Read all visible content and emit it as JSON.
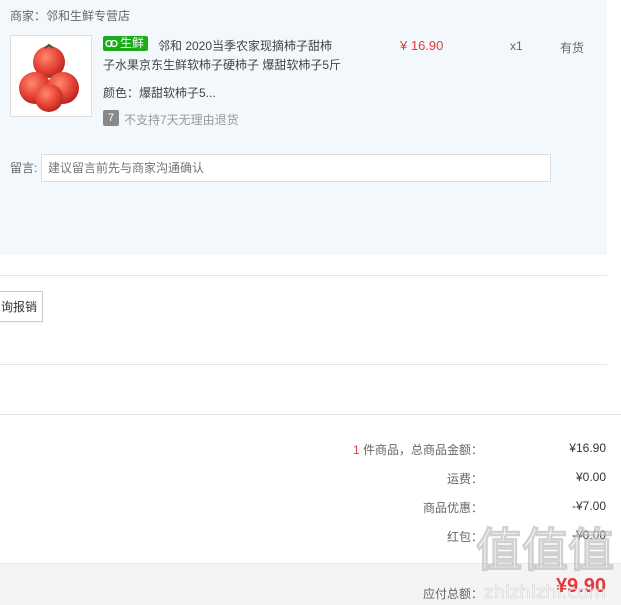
{
  "merchant": {
    "label": "商家：邻和生鲜专营店"
  },
  "item": {
    "badge": "生鲜",
    "title_line1": "邻和 2020当季农家现摘柿子甜柿",
    "title_line2": "子水果京东生鲜软柿子硬柿子 爆甜软柿子5斤",
    "variant": "颜色：爆甜软柿子5...",
    "return_icon": "7",
    "return_policy": "不支持7天无理由退货",
    "price": "¥ 16.90",
    "quantity": "x1",
    "stock": "有货"
  },
  "message": {
    "label": "留言:",
    "placeholder": "建议留言前先与商家沟通确认"
  },
  "reimbursement_button": "询报销",
  "summary": {
    "count": "1",
    "total_label": " 件商品，总商品金额：",
    "total_value": "¥16.90",
    "shipping_label": "运费：",
    "shipping_value": "¥0.00",
    "discount_label": "商品优惠：",
    "discount_value": "-¥7.00",
    "redpacket_label": "红包：",
    "redpacket_value": "-¥0.00"
  },
  "payable": {
    "label": "应付总额：",
    "value": "¥9.90"
  },
  "watermark": {
    "brand": "值值值",
    "site": "zhizhizhi.com"
  },
  "colors": {
    "price_red": "#e4393c",
    "badge_green": "#1aad19",
    "panel_bg": "#f3f8fd"
  }
}
